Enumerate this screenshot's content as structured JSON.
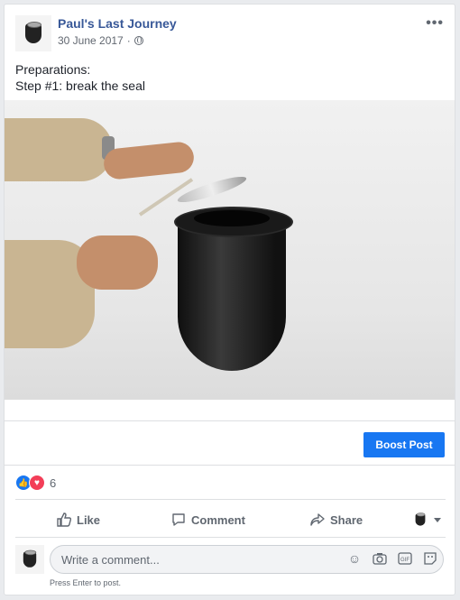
{
  "post": {
    "page_name": "Paul's Last Journey",
    "date": "30 June 2017",
    "separator": "·",
    "text_line1": "Preparations:",
    "text_line2": "Step #1: break the seal"
  },
  "toolbar": {
    "boost_label": "Boost Post"
  },
  "reactions": {
    "count": "6"
  },
  "actions": {
    "like": "Like",
    "comment": "Comment",
    "share": "Share"
  },
  "comment_box": {
    "placeholder": "Write a comment...",
    "hint": "Press Enter to post."
  },
  "icons": [
    "globe-icon",
    "more-icon",
    "like-icon",
    "comment-icon",
    "share-icon",
    "emoji-icon",
    "camera-icon",
    "gif-icon",
    "sticker-icon"
  ],
  "colors": {
    "accent": "#1877f2",
    "link": "#385898",
    "love": "#f33e58"
  }
}
